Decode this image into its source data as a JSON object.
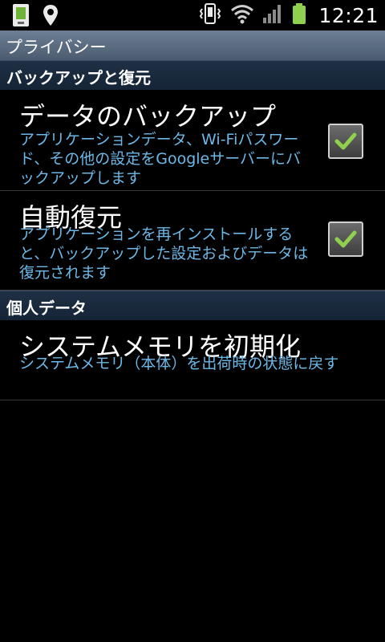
{
  "status_bar": {
    "time": "12:21",
    "icons": [
      "sim-card-icon",
      "location-pin-icon",
      "vibrate-icon",
      "wifi-icon",
      "signal-icon",
      "battery-icon"
    ]
  },
  "header": {
    "title": "プライバシー"
  },
  "sections": [
    {
      "header": "バックアップと復元",
      "items": [
        {
          "title": "データのバックアップ",
          "summary": "アプリケーションデータ、Wi-Fiパスワード、その他の設定をGoogleサーバーにバックアップします",
          "checked": true
        },
        {
          "title": "自動復元",
          "summary": "アプリケーションを再インストールすると、バックアップした設定およびデータは復元されます",
          "checked": true
        }
      ]
    },
    {
      "header": "個人データ",
      "items": [
        {
          "title": "システムメモリを初期化",
          "summary": "システムメモリ（本体）を出荷時の状態に戻す"
        }
      ]
    }
  ],
  "colors": {
    "accent_summary": "#6cb8e8",
    "checkmark": "#8fd14f",
    "title_bar": "#5b6d82",
    "section_header": "#1a2b3f"
  }
}
